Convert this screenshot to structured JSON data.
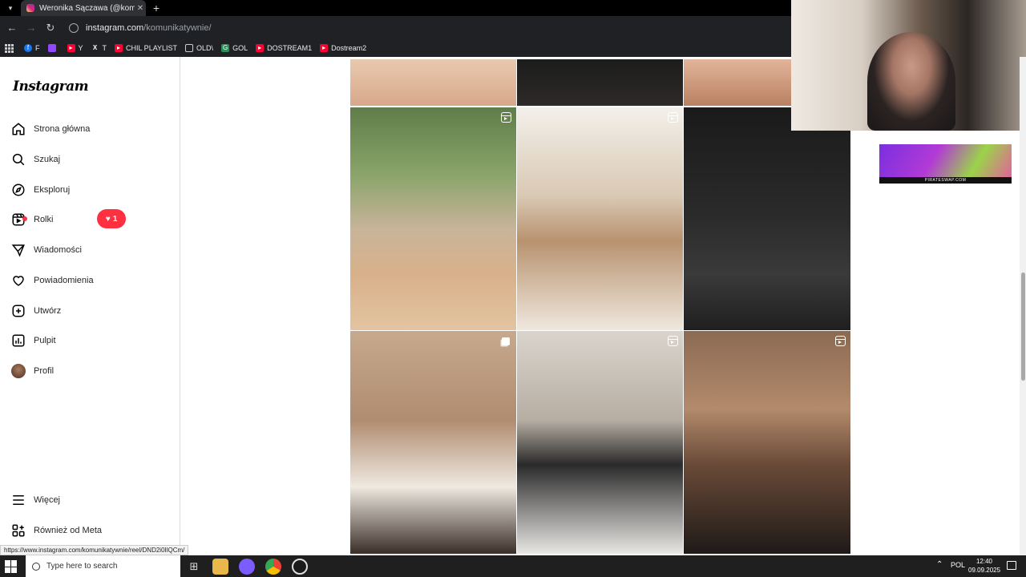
{
  "browser": {
    "tab_title": "Weronika Sączawa (@komunikatywnie)",
    "url_host": "instagram.com",
    "url_path": "/komunikatywnie/",
    "status_url": "https://www.instagram.com/komunikatywnie/reel/DND2i0IlQCm/",
    "bookmarks": [
      "F",
      "",
      "Y",
      "T",
      "CHIL PLAYLIST",
      "OLD\\",
      "GOL",
      "DOSTREAM1",
      "Dostream2"
    ]
  },
  "instagram": {
    "logo": "Instagram",
    "nav": [
      {
        "label": "Strona główna",
        "icon": "home-icon"
      },
      {
        "label": "Szukaj",
        "icon": "search-icon"
      },
      {
        "label": "Eksploruj",
        "icon": "explore-icon"
      },
      {
        "label": "Rolki",
        "icon": "reels-icon"
      },
      {
        "label": "Wiadomości",
        "icon": "messages-icon"
      },
      {
        "label": "Powiadomienia",
        "icon": "heart-icon"
      },
      {
        "label": "Utwórz",
        "icon": "create-icon"
      },
      {
        "label": "Pulpit",
        "icon": "dashboard-icon"
      },
      {
        "label": "Profil",
        "icon": "avatar"
      }
    ],
    "notifications_count": "1",
    "bottom_nav": [
      {
        "label": "Więcej",
        "icon": "menu-icon"
      },
      {
        "label": "Również od Meta",
        "icon": "meta-icon"
      }
    ]
  },
  "ad": {
    "label": "PIRATESWAP.COM"
  },
  "taskbar": {
    "search_placeholder": "Type here to search",
    "language": "POL",
    "time": "12:40",
    "date": "09.09.2025"
  },
  "colors": {
    "badge": "#ff3040",
    "accent": "#0095f6"
  }
}
